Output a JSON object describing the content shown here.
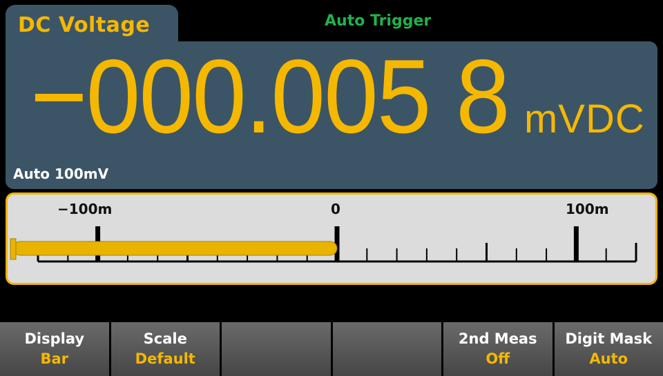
{
  "tab": {
    "label": "DC Voltage"
  },
  "trigger": {
    "label": "Auto Trigger"
  },
  "reading": {
    "value": "−000.005 8",
    "unit": "mVDC"
  },
  "range": {
    "label": "Auto 100mV"
  },
  "bar": {
    "tick_labels": [
      "−100m",
      "0",
      "100m"
    ],
    "value_fraction": 0.0,
    "range_min": -100,
    "range_max": 100
  },
  "softkeys": [
    {
      "title": "Display",
      "value": "Bar"
    },
    {
      "title": "Scale",
      "value": "Default"
    },
    {
      "title": "",
      "value": ""
    },
    {
      "title": "",
      "value": ""
    },
    {
      "title": "2nd Meas",
      "value": "Off"
    },
    {
      "title": "Digit Mask",
      "value": "Auto"
    }
  ],
  "colors": {
    "panel": "#3c5566",
    "accent": "#f5b800",
    "trigger": "#1fb24a",
    "bar_bg": "#dcdcdc"
  }
}
